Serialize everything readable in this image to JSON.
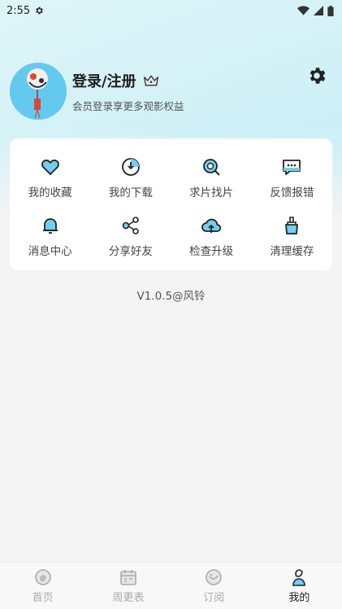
{
  "status_bar": {
    "time": "2:55",
    "icons": [
      "settings-gear-icon",
      "wifi-icon",
      "signal-icon",
      "battery-icon"
    ]
  },
  "profile": {
    "login_label": "登录/注册",
    "subtitle": "会员登录享更多观影权益",
    "avatar_icon": "wind-chime-avatar",
    "crown_icon": "crown-icon",
    "settings_icon": "gear-icon"
  },
  "menu": {
    "items": [
      {
        "label": "我的收藏",
        "icon": "heart-icon"
      },
      {
        "label": "我的下载",
        "icon": "download-icon"
      },
      {
        "label": "求片找片",
        "icon": "search-film-icon"
      },
      {
        "label": "反馈报错",
        "icon": "feedback-icon"
      },
      {
        "label": "消息中心",
        "icon": "bell-icon"
      },
      {
        "label": "分享好友",
        "icon": "share-icon"
      },
      {
        "label": "检查升级",
        "icon": "upgrade-icon"
      },
      {
        "label": "清理缓存",
        "icon": "clean-icon"
      }
    ]
  },
  "version": "V1.0.5@风铃",
  "bottom_nav": {
    "items": [
      {
        "label": "首页",
        "icon": "home-icon",
        "active": false
      },
      {
        "label": "周更表",
        "icon": "calendar-icon",
        "active": false
      },
      {
        "label": "订阅",
        "icon": "subscribe-icon",
        "active": false
      },
      {
        "label": "我的",
        "icon": "profile-icon",
        "active": true
      }
    ]
  },
  "colors": {
    "accent": "#6fd0ef",
    "header_gradient_start": "#dff5f8",
    "header_gradient_end": "#b6e9f5",
    "background": "#f4f4f4",
    "inactive_nav": "#aaaaaa"
  }
}
